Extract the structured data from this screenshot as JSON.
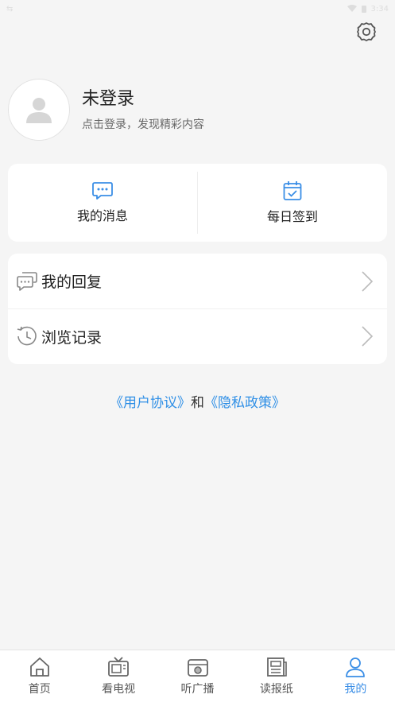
{
  "status_bar": {
    "time": "3:34",
    "left_glyph": "⇆"
  },
  "settings": {
    "icon": "gear-icon"
  },
  "profile": {
    "title": "未登录",
    "subtitle": "点击登录，发现精彩内容"
  },
  "quick_actions": [
    {
      "label": "我的消息",
      "icon": "chat-bubble-icon"
    },
    {
      "label": "每日签到",
      "icon": "calendar-check-icon"
    }
  ],
  "menu": [
    {
      "label": "我的回复",
      "icon": "reply-bubbles-icon"
    },
    {
      "label": "浏览记录",
      "icon": "history-clock-icon"
    }
  ],
  "agreement": {
    "user_agreement": "《用户协议》",
    "conjunction": "和",
    "privacy_policy": "《隐私政策》"
  },
  "tabs": [
    {
      "label": "首页",
      "icon": "home-icon"
    },
    {
      "label": "看电视",
      "icon": "tv-icon"
    },
    {
      "label": "听广播",
      "icon": "radio-icon"
    },
    {
      "label": "读报纸",
      "icon": "newspaper-icon"
    },
    {
      "label": "我的",
      "icon": "user-icon",
      "active": true
    }
  ],
  "colors": {
    "accent": "#3a8ee6",
    "link": "#2f8fe6",
    "background": "#f5f5f5"
  }
}
